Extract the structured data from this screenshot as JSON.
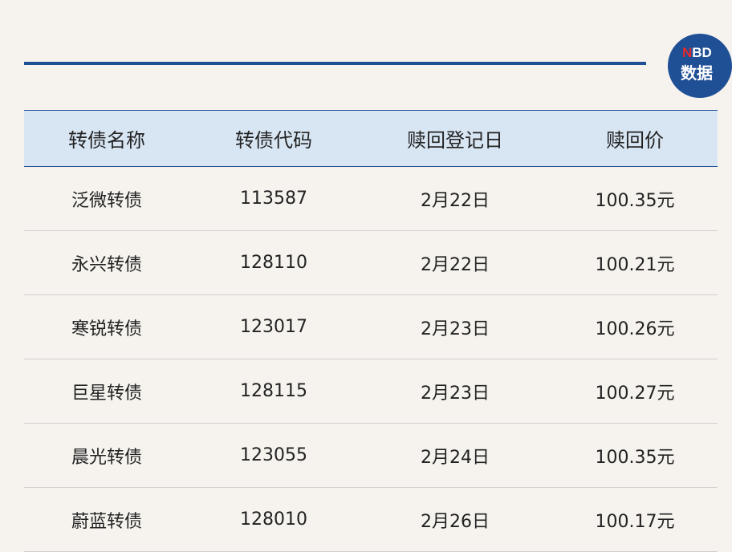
{
  "logo": {
    "brand_n": "N",
    "brand_rest": "BD",
    "label": "数据"
  },
  "table": {
    "headers": [
      "转债名称",
      "转债代码",
      "赎回登记日",
      "赎回价"
    ],
    "rows": [
      [
        "泛微转债",
        "113587",
        "2月22日",
        "100.35元"
      ],
      [
        "永兴转债",
        "128110",
        "2月22日",
        "100.21元"
      ],
      [
        "寒锐转债",
        "123017",
        "2月23日",
        "100.26元"
      ],
      [
        "巨星转债",
        "128115",
        "2月23日",
        "100.27元"
      ],
      [
        "晨光转债",
        "123055",
        "2月24日",
        "100.35元"
      ],
      [
        "蔚蓝转债",
        "128010",
        "2月26日",
        "100.17元"
      ]
    ]
  },
  "colors": {
    "accent": "#1f4f94",
    "header_bg": "#d8e6f4",
    "brand_red": "#e3292d",
    "page_bg": "#f6f3ef"
  }
}
